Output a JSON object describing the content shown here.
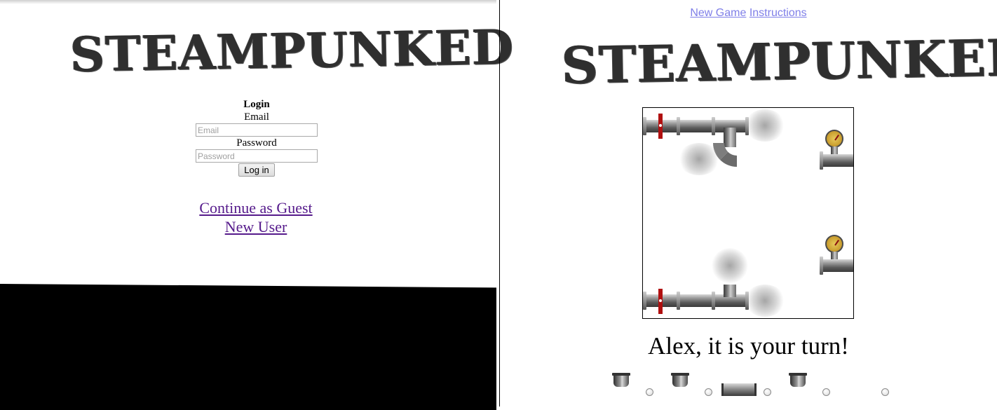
{
  "login_page": {
    "logo_text": "STEAMPUNKED",
    "form": {
      "heading": "Login",
      "email_label": "Email",
      "email_placeholder": "Email",
      "email_value": "",
      "password_label": "Password",
      "password_placeholder": "Password",
      "password_value": "",
      "submit_label": "Log in"
    },
    "links": {
      "guest": "Continue as Guest",
      "new_user": "New User"
    }
  },
  "game_page": {
    "nav": {
      "new_game": "New Game",
      "instructions": "Instructions"
    },
    "logo_text": "STEAMPUNKED",
    "turn_message": "Alex, it is your turn!",
    "palette": {
      "pieces": [
        "cap-icon",
        "cap-icon",
        "straight-pipe-icon",
        "cap-icon"
      ],
      "slot_count": 5
    }
  },
  "colors": {
    "link_visited": "#551a8b",
    "nav_link": "#7f7fe8",
    "valve_red": "#b01010"
  }
}
